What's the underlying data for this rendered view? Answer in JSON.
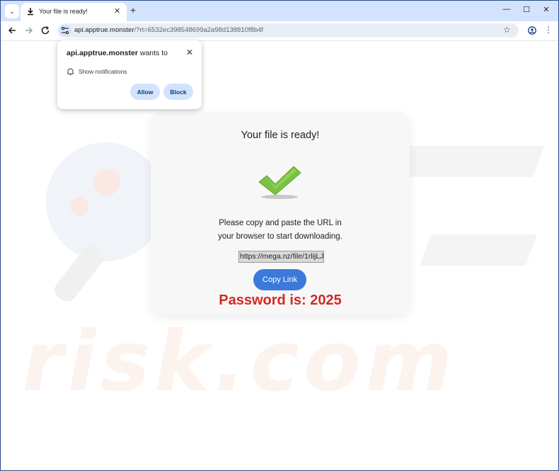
{
  "browser": {
    "tab_title": "Your file is ready!",
    "tab_list_glyph": "⌄",
    "tab_close_glyph": "✕",
    "new_tab_glyph": "+",
    "window_controls": {
      "minimize": "—",
      "maximize": "☐",
      "close": "✕"
    },
    "url_host": "api.apptrue.monster",
    "url_rest": "/?rt=6532ec398548699a2a98d138810f8b4f",
    "star_glyph": "☆",
    "menu_glyph": "⋮",
    "colors": {
      "tabstrip": "#d3e3fd",
      "omnibox": "#e9eef6"
    }
  },
  "notification_popup": {
    "site": "api.apptrue.monster",
    "wants_to": " wants to",
    "permission": "Show notifications",
    "close_glyph": "✕",
    "allow_label": "Allow",
    "block_label": "Block"
  },
  "card": {
    "title": "Your file is ready!",
    "message_line1": "Please copy and paste the URL in",
    "message_line2": "your browser to start downloading.",
    "url_value": "https://mega.nz/file/1rlijLJ",
    "copy_button_label": "Copy Link",
    "password_text": "Password is: 2025",
    "colors": {
      "button": "#3b7ad9",
      "password": "#d32a22",
      "check": "#7cc242"
    }
  },
  "watermark": {
    "text": "risk.com"
  }
}
